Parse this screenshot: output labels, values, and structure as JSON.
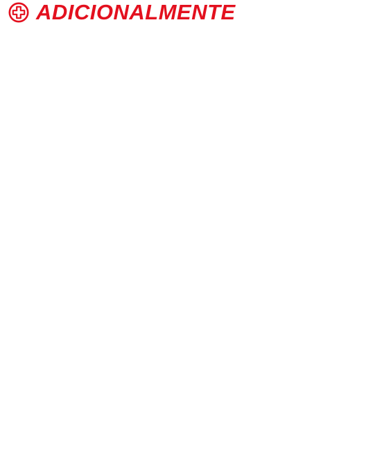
{
  "header": {
    "icon": "plus-circle-icon",
    "title": "ADICIONALMENTE"
  },
  "colors": {
    "accent": "#e3101e",
    "background": "#ffffff"
  }
}
